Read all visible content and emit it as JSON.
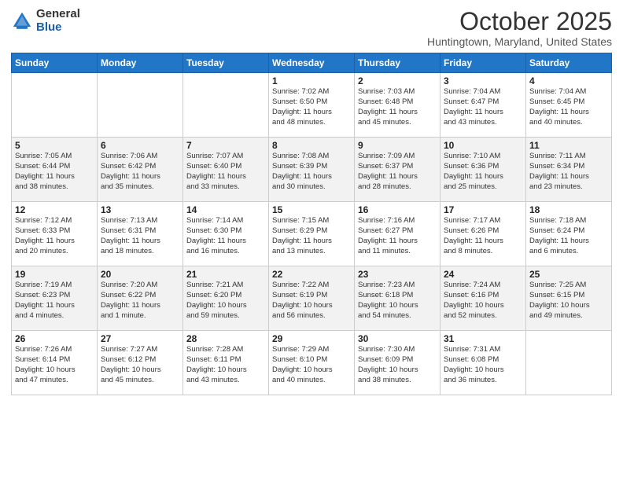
{
  "header": {
    "logo_general": "General",
    "logo_blue": "Blue",
    "month_title": "October 2025",
    "location": "Huntingtown, Maryland, United States"
  },
  "days_of_week": [
    "Sunday",
    "Monday",
    "Tuesday",
    "Wednesday",
    "Thursday",
    "Friday",
    "Saturday"
  ],
  "weeks": [
    [
      {
        "day": "",
        "info": ""
      },
      {
        "day": "",
        "info": ""
      },
      {
        "day": "",
        "info": ""
      },
      {
        "day": "1",
        "info": "Sunrise: 7:02 AM\nSunset: 6:50 PM\nDaylight: 11 hours\nand 48 minutes."
      },
      {
        "day": "2",
        "info": "Sunrise: 7:03 AM\nSunset: 6:48 PM\nDaylight: 11 hours\nand 45 minutes."
      },
      {
        "day": "3",
        "info": "Sunrise: 7:04 AM\nSunset: 6:47 PM\nDaylight: 11 hours\nand 43 minutes."
      },
      {
        "day": "4",
        "info": "Sunrise: 7:04 AM\nSunset: 6:45 PM\nDaylight: 11 hours\nand 40 minutes."
      }
    ],
    [
      {
        "day": "5",
        "info": "Sunrise: 7:05 AM\nSunset: 6:44 PM\nDaylight: 11 hours\nand 38 minutes."
      },
      {
        "day": "6",
        "info": "Sunrise: 7:06 AM\nSunset: 6:42 PM\nDaylight: 11 hours\nand 35 minutes."
      },
      {
        "day": "7",
        "info": "Sunrise: 7:07 AM\nSunset: 6:40 PM\nDaylight: 11 hours\nand 33 minutes."
      },
      {
        "day": "8",
        "info": "Sunrise: 7:08 AM\nSunset: 6:39 PM\nDaylight: 11 hours\nand 30 minutes."
      },
      {
        "day": "9",
        "info": "Sunrise: 7:09 AM\nSunset: 6:37 PM\nDaylight: 11 hours\nand 28 minutes."
      },
      {
        "day": "10",
        "info": "Sunrise: 7:10 AM\nSunset: 6:36 PM\nDaylight: 11 hours\nand 25 minutes."
      },
      {
        "day": "11",
        "info": "Sunrise: 7:11 AM\nSunset: 6:34 PM\nDaylight: 11 hours\nand 23 minutes."
      }
    ],
    [
      {
        "day": "12",
        "info": "Sunrise: 7:12 AM\nSunset: 6:33 PM\nDaylight: 11 hours\nand 20 minutes."
      },
      {
        "day": "13",
        "info": "Sunrise: 7:13 AM\nSunset: 6:31 PM\nDaylight: 11 hours\nand 18 minutes."
      },
      {
        "day": "14",
        "info": "Sunrise: 7:14 AM\nSunset: 6:30 PM\nDaylight: 11 hours\nand 16 minutes."
      },
      {
        "day": "15",
        "info": "Sunrise: 7:15 AM\nSunset: 6:29 PM\nDaylight: 11 hours\nand 13 minutes."
      },
      {
        "day": "16",
        "info": "Sunrise: 7:16 AM\nSunset: 6:27 PM\nDaylight: 11 hours\nand 11 minutes."
      },
      {
        "day": "17",
        "info": "Sunrise: 7:17 AM\nSunset: 6:26 PM\nDaylight: 11 hours\nand 8 minutes."
      },
      {
        "day": "18",
        "info": "Sunrise: 7:18 AM\nSunset: 6:24 PM\nDaylight: 11 hours\nand 6 minutes."
      }
    ],
    [
      {
        "day": "19",
        "info": "Sunrise: 7:19 AM\nSunset: 6:23 PM\nDaylight: 11 hours\nand 4 minutes."
      },
      {
        "day": "20",
        "info": "Sunrise: 7:20 AM\nSunset: 6:22 PM\nDaylight: 11 hours\nand 1 minute."
      },
      {
        "day": "21",
        "info": "Sunrise: 7:21 AM\nSunset: 6:20 PM\nDaylight: 10 hours\nand 59 minutes."
      },
      {
        "day": "22",
        "info": "Sunrise: 7:22 AM\nSunset: 6:19 PM\nDaylight: 10 hours\nand 56 minutes."
      },
      {
        "day": "23",
        "info": "Sunrise: 7:23 AM\nSunset: 6:18 PM\nDaylight: 10 hours\nand 54 minutes."
      },
      {
        "day": "24",
        "info": "Sunrise: 7:24 AM\nSunset: 6:16 PM\nDaylight: 10 hours\nand 52 minutes."
      },
      {
        "day": "25",
        "info": "Sunrise: 7:25 AM\nSunset: 6:15 PM\nDaylight: 10 hours\nand 49 minutes."
      }
    ],
    [
      {
        "day": "26",
        "info": "Sunrise: 7:26 AM\nSunset: 6:14 PM\nDaylight: 10 hours\nand 47 minutes."
      },
      {
        "day": "27",
        "info": "Sunrise: 7:27 AM\nSunset: 6:12 PM\nDaylight: 10 hours\nand 45 minutes."
      },
      {
        "day": "28",
        "info": "Sunrise: 7:28 AM\nSunset: 6:11 PM\nDaylight: 10 hours\nand 43 minutes."
      },
      {
        "day": "29",
        "info": "Sunrise: 7:29 AM\nSunset: 6:10 PM\nDaylight: 10 hours\nand 40 minutes."
      },
      {
        "day": "30",
        "info": "Sunrise: 7:30 AM\nSunset: 6:09 PM\nDaylight: 10 hours\nand 38 minutes."
      },
      {
        "day": "31",
        "info": "Sunrise: 7:31 AM\nSunset: 6:08 PM\nDaylight: 10 hours\nand 36 minutes."
      },
      {
        "day": "",
        "info": ""
      }
    ]
  ]
}
